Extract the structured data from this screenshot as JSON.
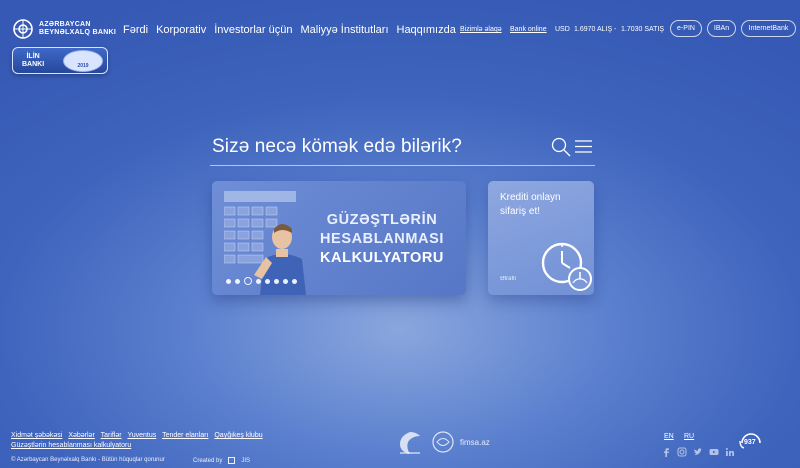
{
  "header": {
    "logo": {
      "line1": "AZƏRBAYCAN",
      "line2": "BEYNƏLXALQ BANKI"
    },
    "badge": {
      "line1": "İLİN",
      "line2": "BANKI",
      "seal_text": "2019"
    },
    "nav": [
      "Fərdi",
      "Korporativ",
      "İnvestorlar üçün",
      "Maliyyə İnstitutları",
      "Haqqımızda"
    ],
    "contact_link": "Bizimlə əlaqə",
    "bank_online_link": "Bank online",
    "currency": {
      "code": "USD",
      "buy": "1.6970 ALIŞ",
      "sep": "-",
      "sell": "1.7030 SATIŞ"
    },
    "pills": [
      "e-PIN",
      "IBAn",
      "InternetBank"
    ]
  },
  "search": {
    "question": "Sizə necə kömək edə bilərik?"
  },
  "banner": {
    "line1": "GÜZƏŞTLƏRİN",
    "line2": "HESABLANMASI",
    "line3": "KALKULYATORU",
    "slides": 8,
    "active_slide": 3
  },
  "card2": {
    "text": "Krediti onlayn sifariş et!",
    "more": "Ətraflı"
  },
  "footer": {
    "links_row1": [
      "Xidmət şəbəkəsi",
      "Xəbərlər",
      "Tariflər",
      "Yuventus",
      "Tender elanları",
      "Qayğıkeş klubu"
    ],
    "links_row2": [
      "Güzəştlərin hesablanması kalkulyatoru"
    ],
    "copyright": "© Azərbaycan Beynəlxalq Bankı - Bütün hüquqlar qorunur",
    "created_by": "Created by",
    "creator": "JIS",
    "partner_text": "fimsa.az",
    "langs": [
      "EN",
      "RU"
    ],
    "hotline": "937",
    "social": [
      "facebook-icon",
      "instagram-icon",
      "twitter-icon",
      "youtube-icon",
      "linkedin-icon"
    ]
  }
}
